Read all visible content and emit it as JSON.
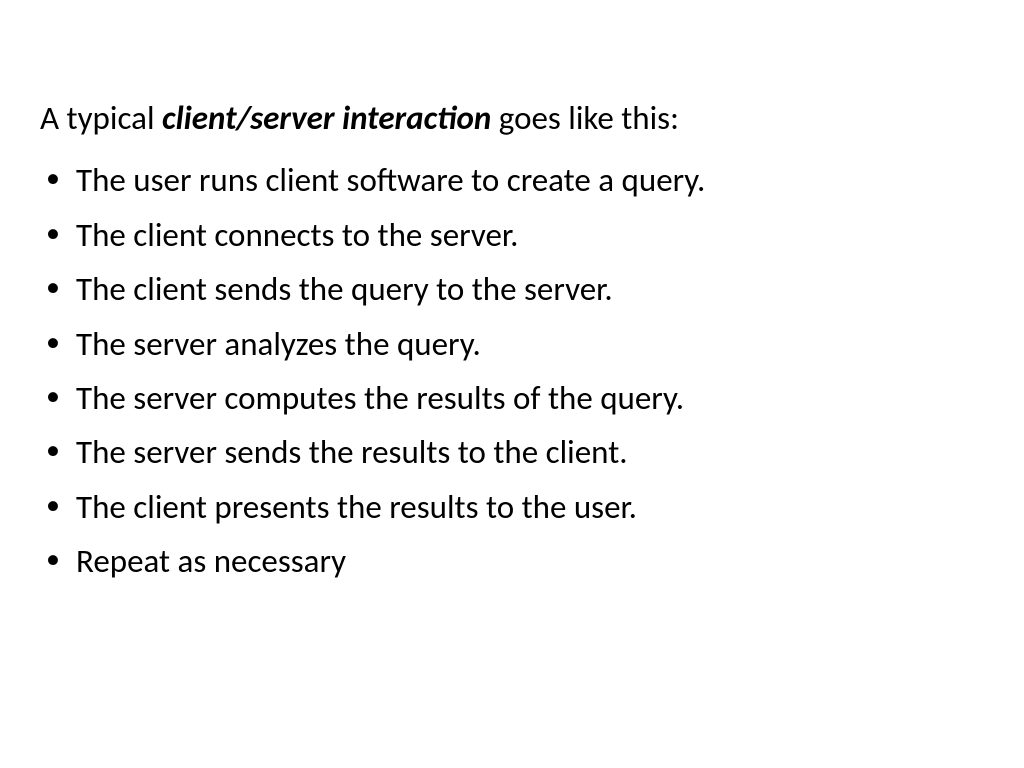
{
  "intro": {
    "prefix": "A typical ",
    "emphasis": "client/server interaction",
    "suffix": " goes like this:"
  },
  "bullets": [
    "The user runs client software to create a query.",
    "The client connects to the server.",
    "The client sends the query to the server.",
    "The server analyzes the query.",
    "The server computes the results of the query.",
    "The server sends the results to the client.",
    "The client presents the results to the user.",
    "Repeat as necessary"
  ]
}
